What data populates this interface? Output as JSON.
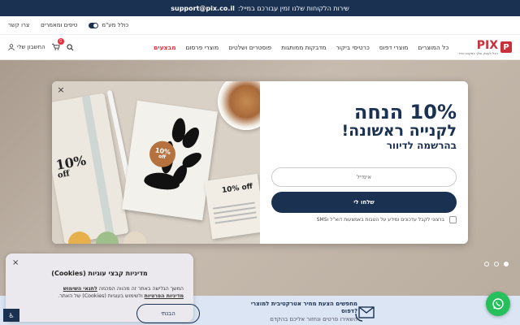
{
  "topbar": {
    "text": "שירות הלקוחות שלנו זמין עבורכם במייל:",
    "email": "support@pix.co.il"
  },
  "utility": {
    "contact": "צרו קשר",
    "tips": "טיפים ומאמרים",
    "vat_toggle": "כולל מע\"מ"
  },
  "nav": {
    "account": "החשבון שלי",
    "cart_count": "0",
    "menu": [
      "כל המוצרים",
      "מוצרי דפוס",
      "כרטיסי ביקור",
      "מדבקות ממותגות",
      "פוסטרים ושלטים",
      "מוצרי פרסום",
      "מבצעים"
    ],
    "logo_name": "PIX",
    "logo_mark": "P",
    "logo_sub": "הכל לעסק שלך במקום אחד"
  },
  "modal": {
    "headline": "10% הנחה",
    "subheadline": "לקנייה ראשונה!",
    "subline": "בהרשמה לדיוור",
    "email_placeholder": "אימייל",
    "submit_label": "שלחו לי",
    "consent": "ברצוני לקבל עדכונים ומידע על הטבות באמצעות דוא\"ל וSMS",
    "image_text_1": "10%",
    "image_text_2": "off",
    "sticker_1": "10%",
    "sticker_2": "off",
    "card_text": "10% off",
    "close": "×"
  },
  "hero": {
    "slides": 3,
    "active_slide": 1
  },
  "promo": {
    "title": "מחפשים הצעת מחיר אטרקטיבית למוצרי דפוס?",
    "sub": "השאירו פרטים ונחזור אליכם בהקדם"
  },
  "cookie": {
    "title": "מדיניות קבצי עוגיות (Cookies)",
    "text_1": "המשך הגלישה באתר זה מהווה הסכמה",
    "link_terms": "לתנאי השימוש",
    "text_2": "ולשימוש בעוגיות (Cookies) של האתר.",
    "link_privacy": "מדיניות הפרטיות",
    "button": "הבנתי",
    "close": "×"
  },
  "accessibility_label": "♿",
  "colors": {
    "navy": "#1b3152",
    "brand_red": "#c9303a",
    "sale_red": "#e5303b",
    "whatsapp": "#25c05c"
  }
}
